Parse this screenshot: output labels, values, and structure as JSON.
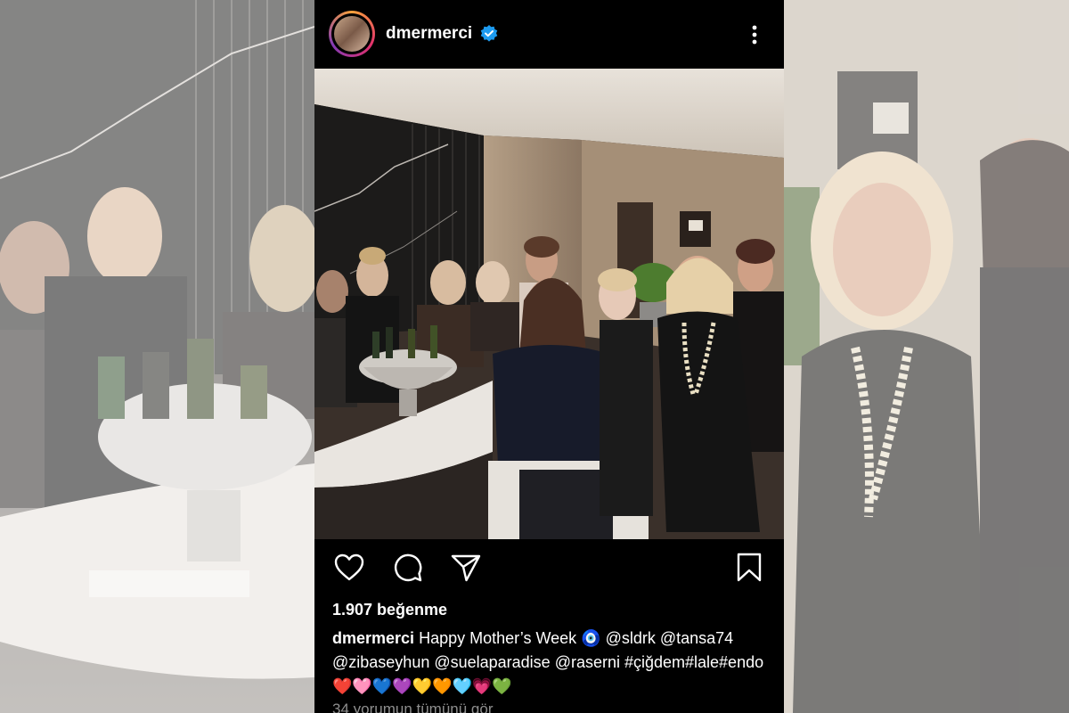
{
  "post": {
    "username": "dmermerci",
    "verified_icon": "verified-badge-icon",
    "likes_text": "1.907 beğenme",
    "caption_username": "dmermerci",
    "caption_text": "Happy Mother’s Week 🧿 @sldrk @tansa74 @zibaseyhun @suelaparadise @raserni #çiğdem#lale#endo❤️🩷💙💜💛🧡🩵💗💚",
    "comments_link": "34 yorumun tümünü gör"
  },
  "icons": {
    "like": "heart-icon",
    "comment": "comment-icon",
    "share": "paper-plane-icon",
    "save": "bookmark-icon",
    "more": "more-vertical-icon"
  },
  "colors": {
    "background": "#000000",
    "text": "#ffffff",
    "muted": "#8e8e8e",
    "verified": "#1d9bf0"
  }
}
